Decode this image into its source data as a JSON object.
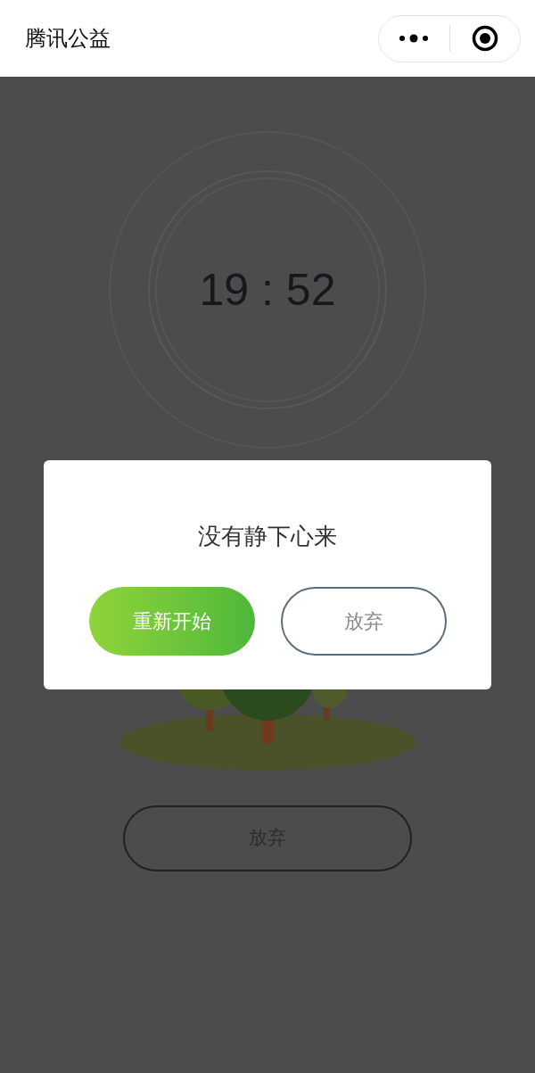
{
  "header": {
    "title": "腾讯公益"
  },
  "timer": {
    "time": "19 : 52"
  },
  "page_button": {
    "label": "放弃"
  },
  "dialog": {
    "message": "没有静下心来",
    "buttons": [
      {
        "label": "重新开始",
        "kind": "primary"
      },
      {
        "label": "放弃",
        "kind": "secondary"
      }
    ]
  }
}
